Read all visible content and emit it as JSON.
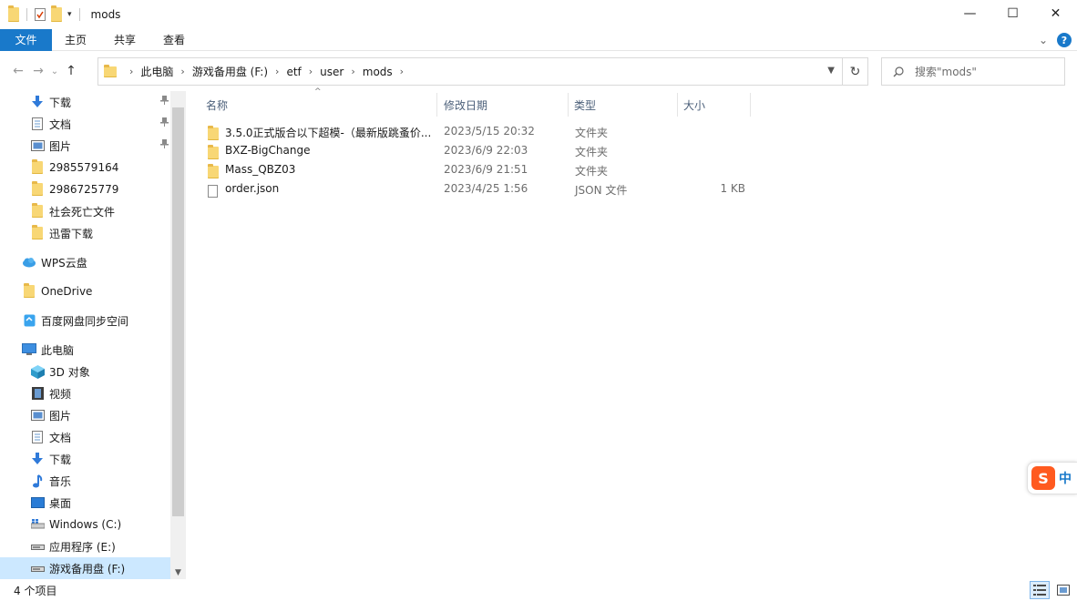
{
  "window": {
    "title": "mods",
    "minimize": "—",
    "maximize": "☐",
    "close": "✕"
  },
  "ribbon": {
    "tabs": [
      "文件",
      "主页",
      "共享",
      "查看"
    ],
    "collapse_glyph": "⌄",
    "help": "?"
  },
  "nav": {
    "back": "←",
    "forward": "→",
    "recent": "⌄",
    "up": "↑",
    "breadcrumb": [
      "此电脑",
      "游戏备用盘 (F:)",
      "etf",
      "user",
      "mods"
    ],
    "refresh": "↻",
    "search_placeholder": "搜索\"mods\""
  },
  "sidebar": {
    "items": [
      {
        "label": "下载",
        "icon": "download-icon",
        "pinned": true
      },
      {
        "label": "文档",
        "icon": "document-icon",
        "pinned": true
      },
      {
        "label": "图片",
        "icon": "pictures-icon",
        "pinned": true
      },
      {
        "label": "2985579164",
        "icon": "folder-icon"
      },
      {
        "label": "2986725779",
        "icon": "folder-icon"
      },
      {
        "label": "社会死亡文件",
        "icon": "folder-icon"
      },
      {
        "label": "迅雷下载",
        "icon": "folder-icon"
      },
      {
        "label": "WPS云盘",
        "icon": "cloud-icon"
      },
      {
        "label": "OneDrive",
        "icon": "folder-icon"
      },
      {
        "label": "百度网盘同步空间",
        "icon": "baidu-sync-icon"
      },
      {
        "label": "此电脑",
        "icon": "computer-icon"
      },
      {
        "label": "3D 对象",
        "icon": "cube-icon"
      },
      {
        "label": "视频",
        "icon": "video-icon"
      },
      {
        "label": "图片",
        "icon": "pictures-icon"
      },
      {
        "label": "文档",
        "icon": "document-icon"
      },
      {
        "label": "下载",
        "icon": "download-icon"
      },
      {
        "label": "音乐",
        "icon": "music-icon"
      },
      {
        "label": "桌面",
        "icon": "desktop-icon"
      },
      {
        "label": "Windows (C:)",
        "icon": "drive-windows-icon"
      },
      {
        "label": "应用程序 (E:)",
        "icon": "drive-icon"
      },
      {
        "label": "游戏备用盘 (F:)",
        "icon": "drive-icon",
        "selected": true
      }
    ]
  },
  "columns": {
    "name": "名称",
    "modified": "修改日期",
    "type": "类型",
    "size": "大小"
  },
  "files": [
    {
      "name": "3.5.0正式版合以下超模-（最新版跳蚤价...",
      "modified": "2023/5/15 20:32",
      "type": "文件夹",
      "size": "",
      "icon": "folder-icon"
    },
    {
      "name": "BXZ-BigChange",
      "modified": "2023/6/9 22:03",
      "type": "文件夹",
      "size": "",
      "icon": "folder-icon"
    },
    {
      "name": "Mass_QBZ03",
      "modified": "2023/6/9 21:51",
      "type": "文件夹",
      "size": "",
      "icon": "folder-icon"
    },
    {
      "name": "order.json",
      "modified": "2023/4/25 1:56",
      "type": "JSON 文件",
      "size": "1 KB",
      "icon": "file-icon"
    }
  ],
  "status": {
    "item_count": "4 个项目"
  },
  "ime": {
    "logo": "S",
    "lang": "中"
  }
}
